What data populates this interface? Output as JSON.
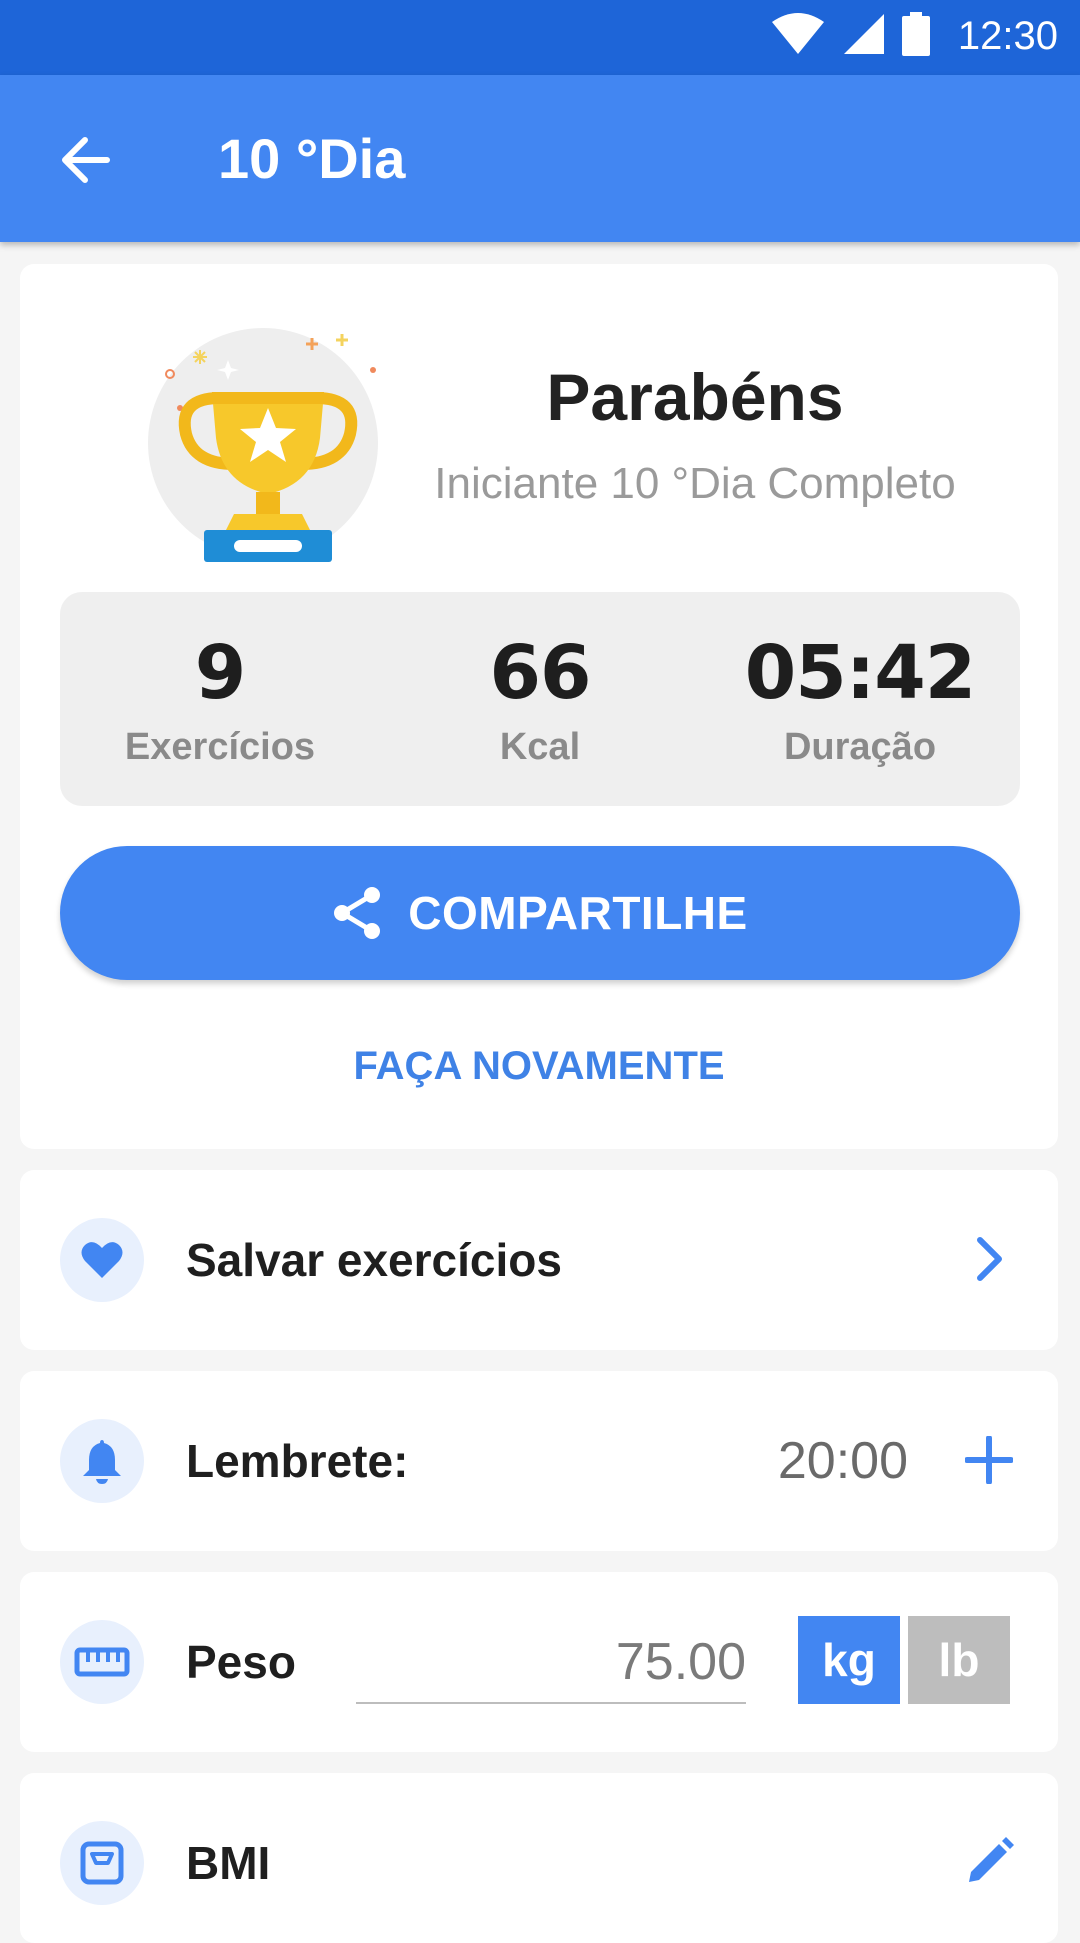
{
  "status_bar": {
    "time": "12:30"
  },
  "app_bar": {
    "title": "10 °Dia"
  },
  "summary": {
    "title": "Parabéns",
    "subtitle": "Iniciante 10 °Dia Completo",
    "stats": [
      {
        "value": "9",
        "label": "Exercícios"
      },
      {
        "value": "66",
        "label": "Kcal"
      },
      {
        "value": "05:42",
        "label": "Duração"
      }
    ],
    "share_label": "COMPARTILHE",
    "again_label": "FAÇA NOVAMENTE"
  },
  "save_workouts": {
    "label": "Salvar exercícios"
  },
  "reminder": {
    "label": "Lembrete:",
    "time": "20:00"
  },
  "weight": {
    "label": "Peso",
    "value": "75.00",
    "unit_kg": "kg",
    "unit_lb": "lb",
    "selected_unit": "kg"
  },
  "bmi": {
    "label": "BMI"
  },
  "colors": {
    "primary": "#4286f2",
    "status_bar": "#1e65d8",
    "background": "#f5f5f5",
    "icon_circle": "#e8f0fd"
  },
  "icons": {
    "back": "arrow-left-icon",
    "share": "share-icon",
    "heart": "heart-icon",
    "chevron": "chevron-right-icon",
    "bell": "bell-icon",
    "plus": "plus-icon",
    "ruler": "ruler-icon",
    "scale": "scale-icon",
    "edit": "pencil-icon",
    "trophy": "trophy-icon"
  }
}
